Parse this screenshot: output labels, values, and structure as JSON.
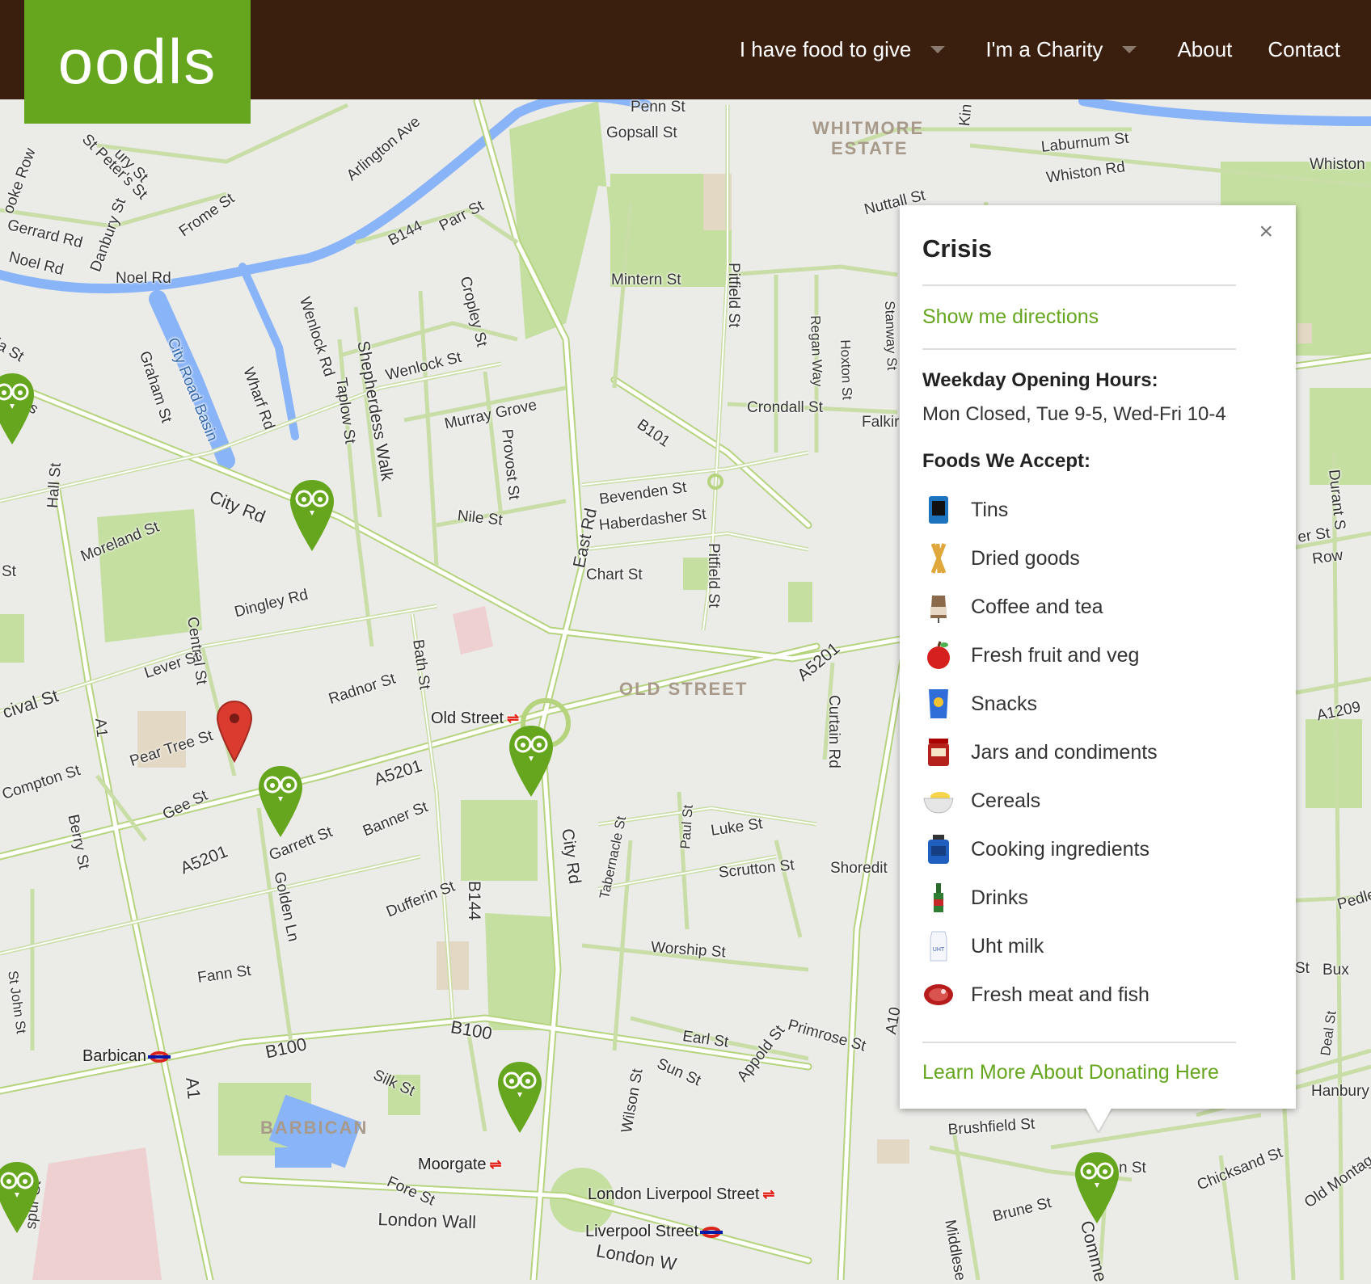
{
  "header": {
    "logo_text": "oodls",
    "nav": [
      {
        "label": "I have food to give",
        "dropdown": true
      },
      {
        "label": "I'm a Charity",
        "dropdown": true
      },
      {
        "label": "About",
        "dropdown": false
      },
      {
        "label": "Contact",
        "dropdown": false
      }
    ]
  },
  "map": {
    "area_labels": [
      "WHITMORE",
      "ESTATE",
      "OLD STREET",
      "BARBICAN"
    ],
    "stations": {
      "old_street": "Old Street",
      "barbican": "Barbican",
      "moorgate": "Moorgate",
      "london_liverpool_street": "London Liverpool Street",
      "liverpool_street": "Liverpool Street"
    },
    "street_labels": [
      "Gopsall St",
      "Laburnum St",
      "Whiston Rd",
      "Whiston",
      "Nuttall St",
      "Arlington Ave",
      "St Peter's St",
      "Frome St",
      "Gerrard Rd",
      "Danbury St",
      "Noel Rd",
      "Noel Rd",
      "B144",
      "Parr St",
      "Mintern St",
      "Pitfield St",
      "Wenlock Rd",
      "Cropley St",
      "City Road Basin",
      "Wharf Rd",
      "Graham St",
      "Shepherdess Walk",
      "Taplow St",
      "Wenlock St",
      "Murray Grove",
      "Provost St",
      "B101",
      "Crondall St",
      "Regan Way",
      "Hoxton St",
      "Stanway St",
      "Falkir",
      "City Rd",
      "Nile St",
      "Bevenden St",
      "Haberdasher St",
      "East Rd",
      "Chart St",
      "Pitfield St",
      "Hall St",
      "Moreland St",
      "Dingley Rd",
      "Central St",
      "Lever St",
      "Bath St",
      "Radnor St",
      "A5201",
      "Curtain Rd",
      "A1209",
      "Pear Tree St",
      "Compton St",
      "A1",
      "A5201",
      "Gee St",
      "Garrett St",
      "Banner St",
      "Berry St",
      "A5201",
      "Golden Ln",
      "Dufferin St",
      "B144",
      "City Rd",
      "Tabernacle St",
      "Paul St",
      "Luke St",
      "Scrutton St",
      "Shoredit",
      "Worship St",
      "Fann St",
      "St John St",
      "B100",
      "B100",
      "Silk St",
      "A1",
      "Earl St",
      "Sun St",
      "Appold St",
      "Primrose St",
      "A10",
      "Wilson St",
      "Brushfield St",
      "Fore St",
      "London Wall",
      "Brune St",
      "Chicksand St",
      "Old Montag",
      "Hanbury",
      "Deal St",
      "Pedle",
      "Durant S",
      "Row",
      "er St",
      "Mews",
      "ia St",
      "St",
      "cival St",
      "ooke Row",
      "Kin",
      "Middlese",
      "Comme",
      "London W",
      "n St",
      "St",
      "Bux",
      "spur St",
      "ury St",
      "Penn St"
    ]
  },
  "popup": {
    "title": "Crisis",
    "directions_link": "Show me directions",
    "hours_heading": "Weekday Opening Hours:",
    "hours_text": "Mon Closed, Tue 9-5, Wed-Fri 10-4",
    "foods_heading": "Foods We Accept:",
    "foods": [
      {
        "label": "Tins",
        "icon": "tin-can-icon"
      },
      {
        "label": "Dried goods",
        "icon": "pasta-icon"
      },
      {
        "label": "Coffee and tea",
        "icon": "coffee-bag-icon"
      },
      {
        "label": "Fresh fruit and veg",
        "icon": "apple-icon"
      },
      {
        "label": "Snacks",
        "icon": "crisps-icon"
      },
      {
        "label": "Jars and condiments",
        "icon": "jar-icon"
      },
      {
        "label": "Cereals",
        "icon": "cereal-bowl-icon"
      },
      {
        "label": "Cooking ingredients",
        "icon": "oil-can-icon"
      },
      {
        "label": "Drinks",
        "icon": "bottle-icon"
      },
      {
        "label": "Uht milk",
        "icon": "milk-carton-icon"
      },
      {
        "label": "Fresh meat and fish",
        "icon": "steak-icon"
      }
    ],
    "milk_icon_text": "UHT",
    "footer_link": "Learn More About Donating Here",
    "close_symbol": "×"
  },
  "colors": {
    "header_bg": "#3b1f0e",
    "brand_green": "#66a61e",
    "marker_red": "#db3b2f",
    "road": "#ffffff",
    "road_edge": "#b6d37e",
    "water": "#8ab4f8",
    "park": "#c5dfa0"
  }
}
